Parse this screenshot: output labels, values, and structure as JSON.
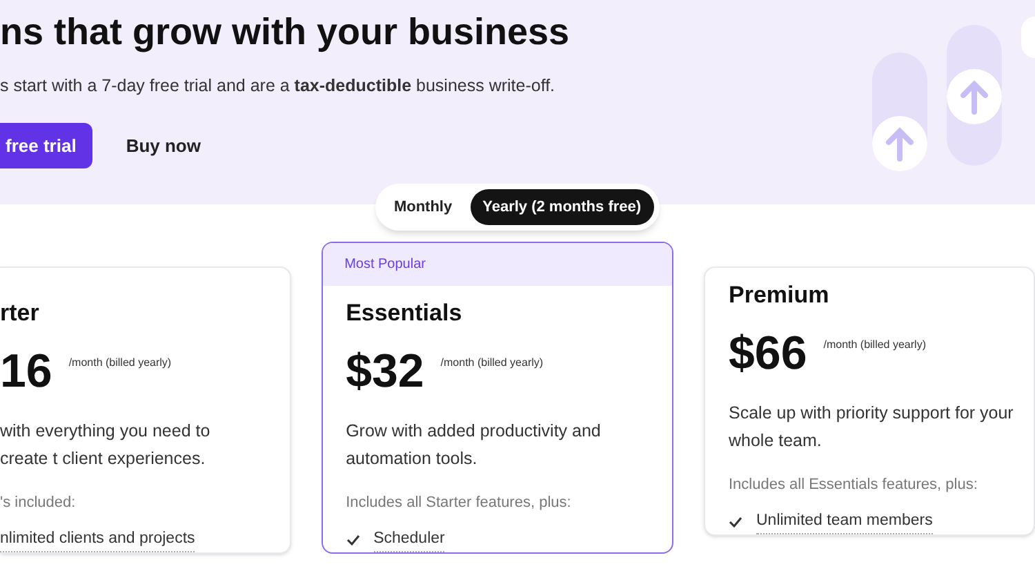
{
  "hero": {
    "title": "ns that grow with your business",
    "subtitle": "s start with a 7-day free trial and are a **tax-deductible** business write-off.",
    "primary_button": "free trial",
    "secondary_button": "Buy now"
  },
  "billing_toggle": [
    {
      "label": "Monthly",
      "selected": false
    },
    {
      "label": "Yearly (2 months free)",
      "selected": true
    }
  ],
  "plans": [
    {
      "name": "rter",
      "price": "16",
      "period": "/month (billed yearly)",
      "description": "with everything you need to create t client experiences.",
      "includes": "'s included:",
      "features": [
        "nlimited clients and projects"
      ],
      "popular": false
    },
    {
      "badge": "Most Popular",
      "name": "Essentials",
      "price": "$32",
      "period": "/month (billed yearly)",
      "description": "Grow with added productivity and automation tools.",
      "includes": "Includes all Starter features, plus:",
      "features": [
        "Scheduler"
      ],
      "popular": true
    },
    {
      "name": "Premium",
      "price": "$66",
      "period": "/month (billed yearly)",
      "description": "Scale up with priority support for your whole team.",
      "includes": "Includes all Essentials features, plus:",
      "features": [
        "Unlimited team members"
      ],
      "popular": false
    }
  ]
}
